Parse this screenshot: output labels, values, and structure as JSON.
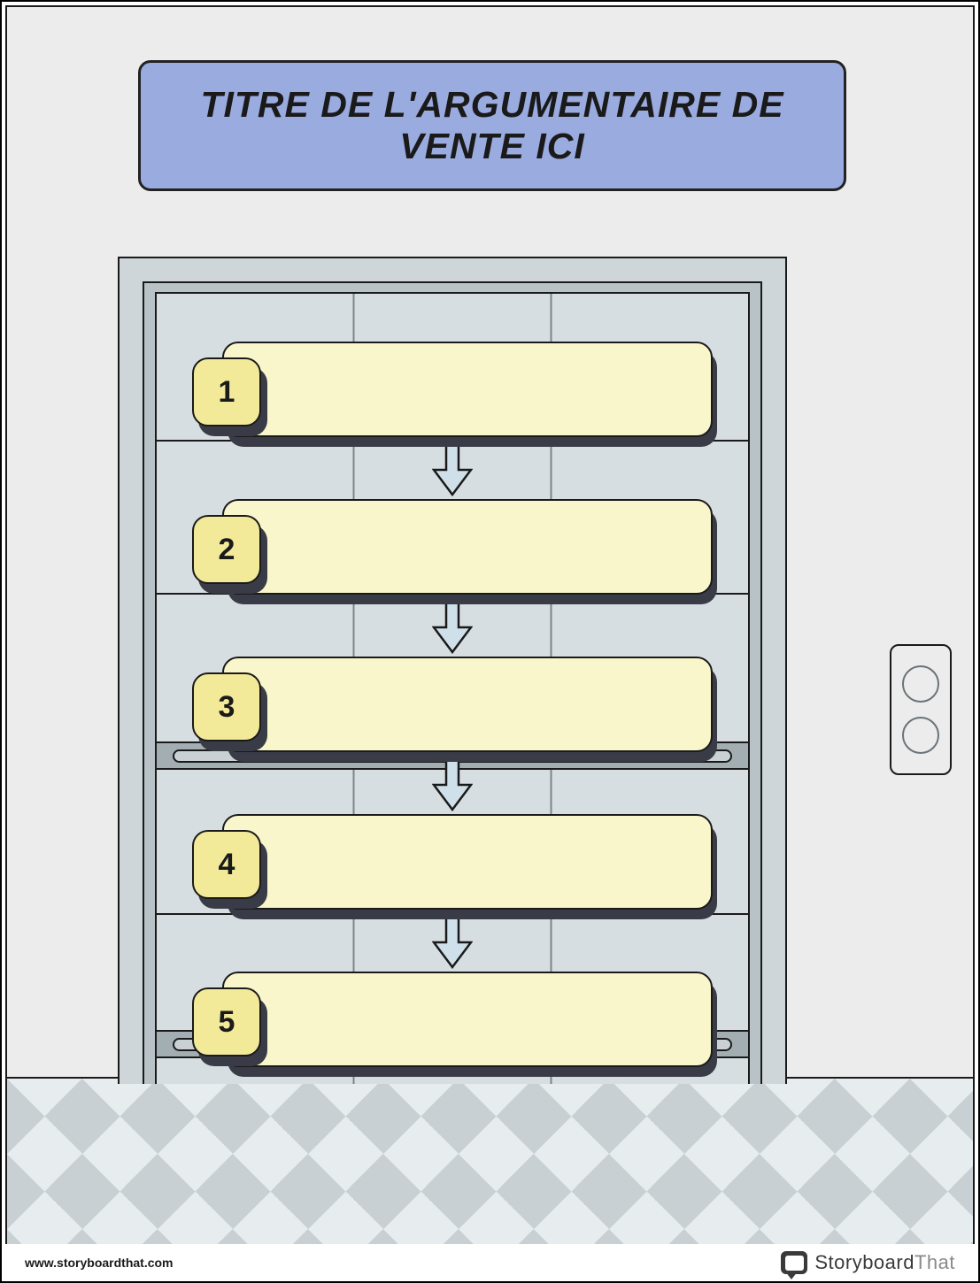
{
  "title": "TITRE DE L'ARGUMENTAIRE DE VENTE ICI",
  "steps": [
    {
      "num": "1",
      "text": ""
    },
    {
      "num": "2",
      "text": ""
    },
    {
      "num": "3",
      "text": ""
    },
    {
      "num": "4",
      "text": ""
    },
    {
      "num": "5",
      "text": ""
    }
  ],
  "footer": {
    "url": "www.storyboardthat.com",
    "brand_a": "Storyboard",
    "brand_b": "That"
  },
  "colors": {
    "title_bg": "#9aabe0",
    "step_bg": "#f9f6cb",
    "num_bg": "#f2e999",
    "arrow_fill": "#cfe0ea"
  }
}
